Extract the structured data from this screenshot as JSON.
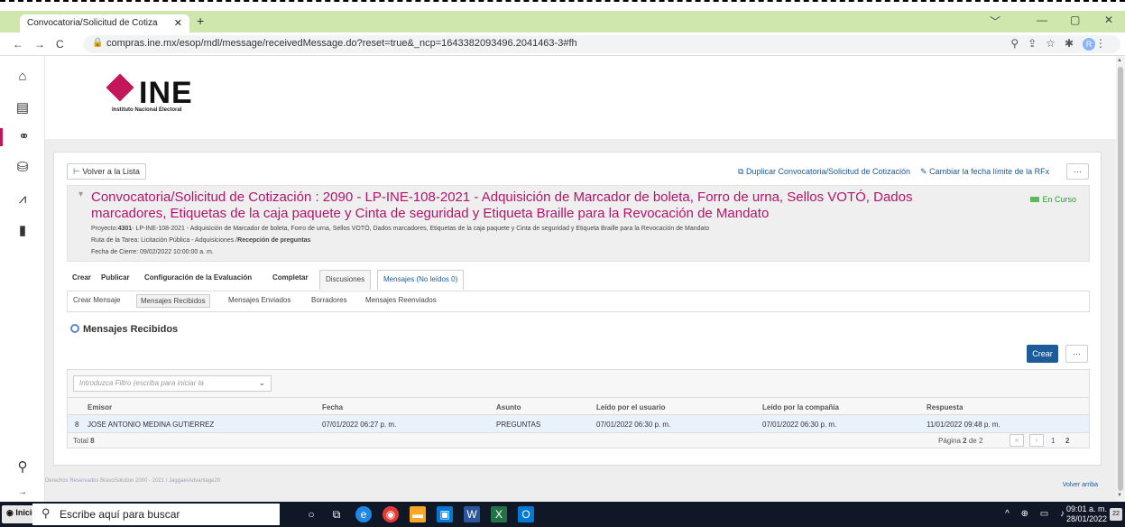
{
  "browser": {
    "tab_title": "Convocatoria/Solicitud de Cotiza",
    "tab_close": "✕",
    "new_tab": "+",
    "url": "compras.ine.mx/esop/mdl/message/receivedMessage.do?reset=true&_ncp=1643382093496.2041463-3#fh",
    "profile_initial": "R",
    "window_controls": [
      "﹀",
      "—",
      "▢",
      "✕"
    ]
  },
  "sidebar": {
    "icons": [
      "home-icon",
      "dashboard-icon",
      "handshake-icon",
      "suppliers-icon",
      "analytics-icon",
      "documents-icon",
      "search-icon",
      "expand-icon"
    ]
  },
  "header": {
    "logo_text": "INE",
    "logo_sub": "Instituto Nacional Electoral"
  },
  "toolbar": {
    "back_label": "Volver a la Lista",
    "duplicate_label": "Duplicar Convocatoria/Solicitud de Cotización",
    "change_date_label": "Cambiar la fecha límite de la RFx",
    "more_label": "···"
  },
  "rfx": {
    "title": "Convocatoria/Solicitud de Cotización : 2090 - LP-INE-108-2021 - Adquisición de Marcador de boleta, Forro de urna, Sellos VOTÓ, Dados marcadores, Etiquetas de la caja paquete y Cinta de seguridad y Etiqueta Braille para la Revocación de Mandato",
    "status": "En Curso",
    "project_label": "Proyecto:",
    "project_code": "4301",
    "project_text": "- LP-INE-108-2021 - Adquisición de Marcador de boleta, Forro de urna, Sellos VOTÓ, Dados marcadores, Etiquetas de la caja paquete y Cinta de seguridad y Etiqueta Braille para la Revocación de Mandato",
    "route_label": "Ruta de la Tarea: Licitación Pública - Adquisiciones /",
    "route_current": "Recepción de preguntas",
    "close_date": "Fecha de Cierre: 09/02/2022 10:00:00 a. m."
  },
  "main_tabs": [
    "Crear",
    "Publicar",
    "Configuración de la Evaluación",
    "Completar",
    "Discusiones",
    "Mensajes (No leídos 0)"
  ],
  "sub_tabs": [
    "Crear Mensaje",
    "Mensajes Recibidos",
    "Mensajes Enviados",
    "Borradores",
    "Mensajes Reenviados"
  ],
  "section_title": "Mensajes Recibidos",
  "create_button": "Crear",
  "more_button": "···",
  "filter_placeholder": "Introduzca Filtro (escriba para iniciar la",
  "table": {
    "columns": [
      "Emisor",
      "Fecha",
      "Asunto",
      "Leído por el usuario",
      "Leído por la compañía",
      "Respuesta"
    ],
    "rows": [
      {
        "index": "8",
        "emisor": "JOSE ANTONIO MEDINA GUTIERREZ",
        "fecha": "07/01/2022 06:27 p. m.",
        "asunto": "PREGUNTAS",
        "leido_usuario": "07/01/2022 06:30 p. m.",
        "leido_compania": "07/01/2022 06:30 p. m.",
        "respuesta": "11/01/2022 09:48 p. m."
      }
    ],
    "total_label": "Total",
    "total_value": "8",
    "page_label": "Página",
    "page_current": "2",
    "page_of": "de 2",
    "page_links": [
      "1",
      "2"
    ]
  },
  "footer": {
    "copyright": "Derechos Reservados BravoSolution 2000 - 2021 / JaggaerAdvantage20",
    "back_to_top": "Volver arriba"
  },
  "taskbar": {
    "start_label": "Inicio",
    "search_placeholder": "Escribe aquí para buscar",
    "time": "09:01 a. m.",
    "date": "28/01/2022",
    "notifications": "22"
  },
  "colors": {
    "accent": "#c2185b",
    "link": "#1a5a96",
    "primary_button": "#1e5b9a",
    "status_green": "#2e9a33",
    "tab_strip": "#cfe6ad"
  }
}
